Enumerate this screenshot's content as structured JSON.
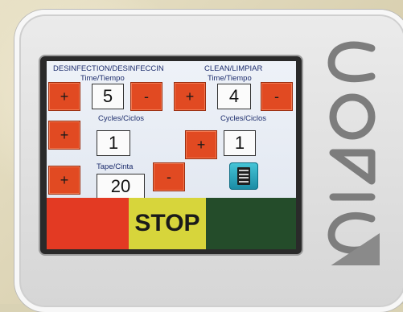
{
  "disinfection": {
    "title": "DESINFECTION/DESINFECCIN",
    "time_label": "Time/Tiempo",
    "time_value": "5",
    "cycles_label": "Cycles/Ciclos",
    "cycles_value": "1",
    "tape_label": "Tape/Cinta",
    "tape_value": "20"
  },
  "clean": {
    "title": "CLEAN/LIMPIAR",
    "time_label": "Time/Tiempo",
    "time_value": "4",
    "cycles_label": "Cycles/Ciclos",
    "cycles_value": "1"
  },
  "buttons": {
    "plus": "+",
    "minus": "-"
  },
  "stop_label": "STOP",
  "icons": {
    "report": "clipboard-icon"
  },
  "brand": {
    "logo_text": "CONIC"
  },
  "colors": {
    "button_red": "#e14a22",
    "bar_red": "#e33a23",
    "bar_yellow": "#d7d53b",
    "bar_green": "#244c2a"
  }
}
